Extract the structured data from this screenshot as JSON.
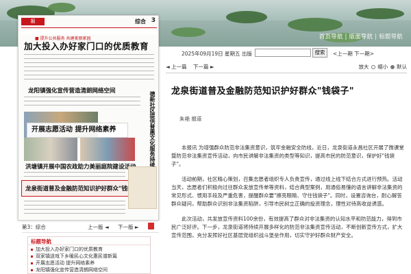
{
  "banner": {
    "nav_links": "首页导航 | 版面导航 | 标题导航"
  },
  "newspaper": {
    "column_name": "综合",
    "page_number": "3",
    "topbar": "■ 提升公共服务  共建美丽家园",
    "headline_main": "加大投入办好家门口的优质教育",
    "headline_2": "龙阳镇强化宣传营造清朗网络空间",
    "vertical_headline": "德新社区提供普惠文化服务持续涵养文明乡风",
    "overlay_headline": "开展志愿活动 提升网络素养",
    "headline_3": "洪塘镇开展中国农政助力美丽庭院建设活动",
    "headline_4": "龙泉街道普及金融防范知识护好群众\"钱袋子\""
  },
  "page_nav": {
    "page_label": "第3：综合",
    "prev_page": "上一版 ◄",
    "next_page": "下一版 ►"
  },
  "toc": {
    "title": "标题导航",
    "items": [
      "加大投入办好家门口的优质教育",
      "双家镇送戏下乡暖民心文化惠民谱新篇",
      "开展志愿活动 提升网络素养",
      "龙阳镇强化宣传营造清朗网络空间"
    ]
  },
  "header": {
    "date_text": "2025年09月19日 星期五 出版",
    "search_placeholder": "",
    "search_button": "搜索",
    "prev_next_period": "<上一期 下一期>"
  },
  "article_toolbar": {
    "prev_article": "上一篇",
    "next_article": "下一篇",
    "zoom_label": "放大",
    "normal_label": "缩小",
    "small_label": "默认"
  },
  "article": {
    "title": "龙泉街道普及金融防范知识护好群众\"钱袋子\"",
    "author": "朱艳  报道",
    "paragraphs": [
      "本报讯  为增强群众防范非法集资意识，筑牢金融安全防线，近日，龙泉街道永昌社区开展了微课堂暨防范非法集资宣传活动，向市民讲解非法集资的类型等知识，提高市民的防范意识，保护好\"钱袋子\"。",
      "活动前期，社区精心策划，召集志愿者组织专人负责宣传，通过线上线下结合方式进行预热。活动当天，志愿者们积极向过往群众发放宣传单等资料，结合典型案例，用通俗易懂的语言讲解非法集资的常见形式、惯用手段及严重危害，提醒群众要\"擦亮眼睛、守住钱袋子\"。同时，设置咨询台，耐心解答群众疑问，帮助群众识别非法集资陷阱，引导市民树立正确的投资理念，理性对待高收益诱惑。",
      "此次活动，共发放宣传资料100余份，有效提高了群众对非法集资的认知水平和防范能力，得到市民广泛好评。下一步，龙泉街道将持续开展多样化的防范非法集资宣传活动，不断创新宣传方式，扩大宣传范围，充分发挥好社区基层党组织战斗堡垒作用，切实守护好群众财产安全。"
    ]
  }
}
